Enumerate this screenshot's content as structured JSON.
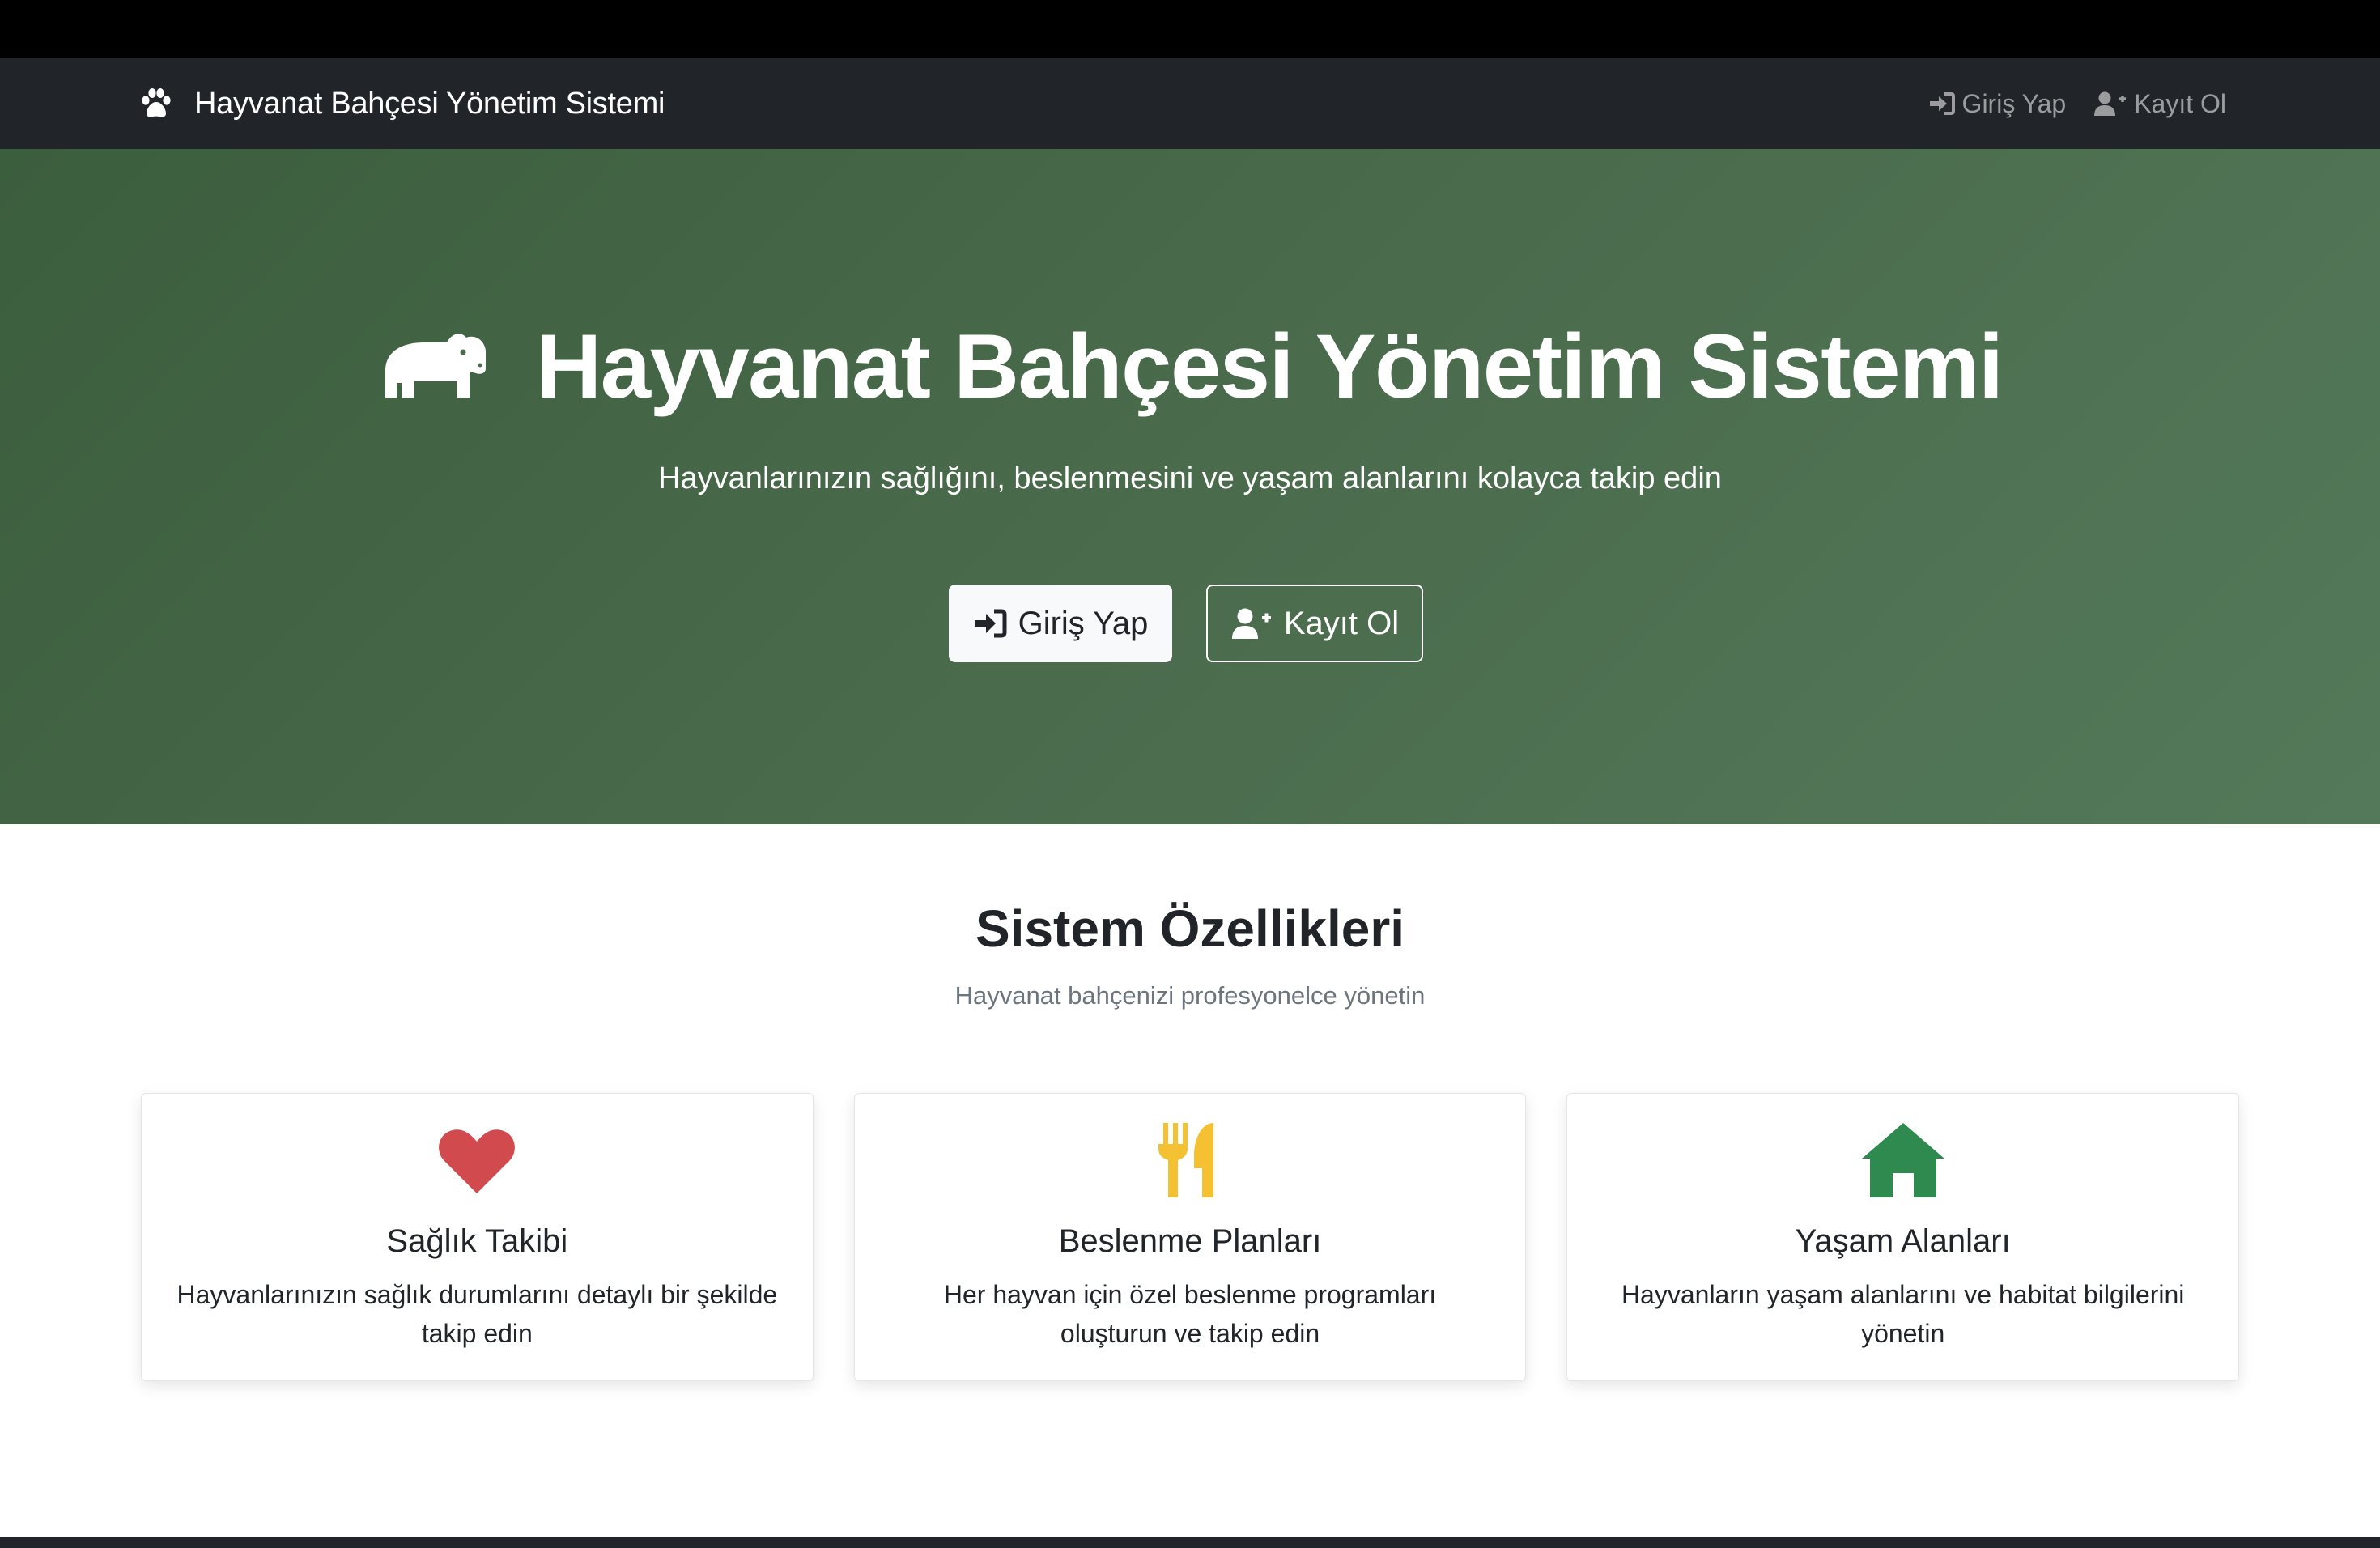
{
  "navbar": {
    "brand": "Hayvanat Bahçesi Yönetim Sistemi",
    "login": "Giriş Yap",
    "register": "Kayıt Ol"
  },
  "hero": {
    "title": "Hayvanat Bahçesi Yönetim Sistemi",
    "subtitle": "Hayvanlarınızın sağlığını, beslenmesini ve yaşam alanlarını kolayca takip edin",
    "login_button": "Giriş Yap",
    "register_button": "Kayıt Ol"
  },
  "features": {
    "title": "Sistem Özellikleri",
    "subtitle": "Hayvanat bahçenizi profesyonelce yönetin",
    "cards": [
      {
        "icon": "heart-icon",
        "color": "#d04a4e",
        "title": "Sağlık Takibi",
        "text": "Hayvanlarınızın sağlık durumlarını detaylı bir şekilde takip edin"
      },
      {
        "icon": "utensils-icon",
        "color": "#f4c133",
        "title": "Beslenme Planları",
        "text": "Her hayvan için özel beslenme programları oluşturun ve takip edin"
      },
      {
        "icon": "house-icon",
        "color": "#2f8a50",
        "title": "Yaşam Alanları",
        "text": "Hayvanların yaşam alanlarını ve habitat bilgilerini yönetin"
      }
    ]
  },
  "colors": {
    "navbar_bg": "#212529",
    "hero_gradient_start": "#3b5e3d",
    "hero_gradient_end": "#53795a"
  }
}
